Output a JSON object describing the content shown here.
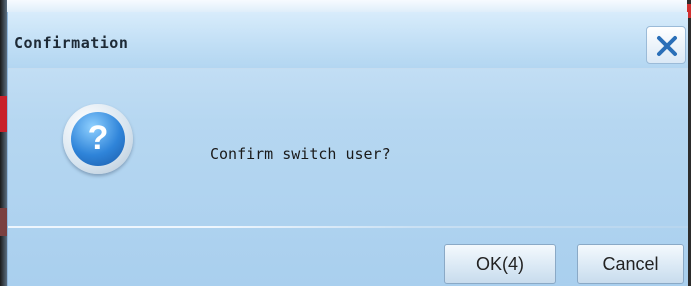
{
  "dialog": {
    "title": "Confirmation",
    "message": "Confirm switch user?",
    "ok_label": "OK(4)",
    "cancel_label": "Cancel"
  },
  "icons": {
    "close": "close-icon",
    "question": "question-icon"
  },
  "colors": {
    "accent": "#2f84d9",
    "dialog_background": "#b6d7f1"
  }
}
